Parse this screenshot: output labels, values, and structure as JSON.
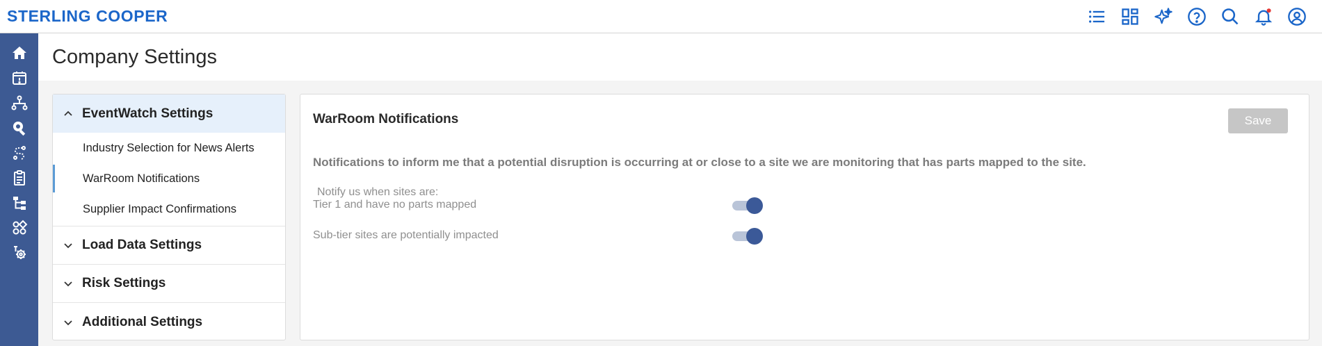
{
  "brand": "STERLING COOPER",
  "colors": {
    "brand": "#1b66c9",
    "sidebar": "#3d5a93",
    "toggle_on": "#3b5998",
    "nav_active_bg": "#e6f0fb",
    "notification_dot": "#e53935"
  },
  "topbar": {
    "icons": [
      "list-icon",
      "dashboard-icon",
      "sparkle-ai-icon",
      "help-icon",
      "search-icon",
      "bell-icon",
      "user-account-icon"
    ]
  },
  "sidebar": {
    "icons": [
      "home-icon",
      "calendar-alert-icon",
      "network-icon",
      "search-location-icon",
      "route-icon",
      "clipboard-icon",
      "hierarchy-icon",
      "apps-icon",
      "gear-tools-icon"
    ]
  },
  "page": {
    "title": "Company Settings"
  },
  "nav": {
    "sections": [
      {
        "label": "EventWatch Settings",
        "expanded": true,
        "items": [
          {
            "label": "Industry Selection for News Alerts"
          },
          {
            "label": "WarRoom Notifications",
            "active": true
          },
          {
            "label": "Supplier Impact Confirmations"
          }
        ]
      },
      {
        "label": "Load Data Settings",
        "expanded": false
      },
      {
        "label": "Risk Settings",
        "expanded": false
      },
      {
        "label": "Additional Settings",
        "expanded": false
      }
    ]
  },
  "content": {
    "title": "WarRoom Notifications",
    "save_label": "Save",
    "description": "Notifications to inform me that a potential disruption is occurring at or close to a site we are monitoring that has parts mapped to the site.",
    "notify_heading": "Notify us when sites are:",
    "options": [
      {
        "label": "Tier 1 and have no parts mapped",
        "enabled": true
      },
      {
        "label": "Sub-tier sites are potentially impacted",
        "enabled": true
      }
    ]
  }
}
